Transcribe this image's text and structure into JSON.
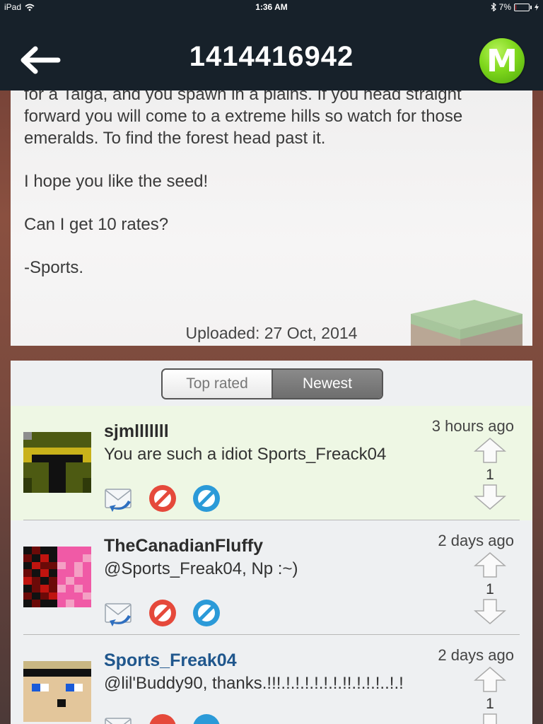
{
  "status": {
    "device": "iPad",
    "time": "1:36 AM",
    "battery": "7%",
    "battery_level": 0.07
  },
  "nav": {
    "title": "1414416942",
    "back_icon": "back-arrow-icon",
    "logo_letter": "M"
  },
  "description": {
    "paragraphs": [
      "for a Taiga, and you spawn in a plains. If you head straight forward you will come to a extreme hills so watch for those emeralds. To find the forest head past it.",
      "I hope you like the seed!",
      "Can I get 10 rates?",
      "-Sports."
    ],
    "uploaded": "Uploaded: 27 Oct, 2014"
  },
  "tabs": {
    "top_rated": "Top rated",
    "newest": "Newest",
    "selected": "Newest"
  },
  "comments": [
    {
      "user": "sjmlllllll",
      "text": "You are such a idiot Sports_Freack04",
      "time": "3 hours ago",
      "votes": "1"
    },
    {
      "user": "TheCanadianFluffy",
      "text": "@Sports_Freak04, Np :~)",
      "time": "2 days ago",
      "votes": "1"
    },
    {
      "user": "Sports_Freak04",
      "text": "@lil'Buddy90, thanks.!!!.!.!.!.!.!.!.!!.!.!.!..!.!",
      "time": "2 days ago",
      "votes": "1"
    }
  ],
  "colors": {
    "nav_bg": "#17212a",
    "logo_green": "#7fd81c",
    "highlight_row": "#eef7e4",
    "author_blue": "#20578d",
    "reply_icon": "reply-envelope-icon",
    "block_icon_red": "#e5493b",
    "block_icon_blue": "#2b9ad8"
  }
}
